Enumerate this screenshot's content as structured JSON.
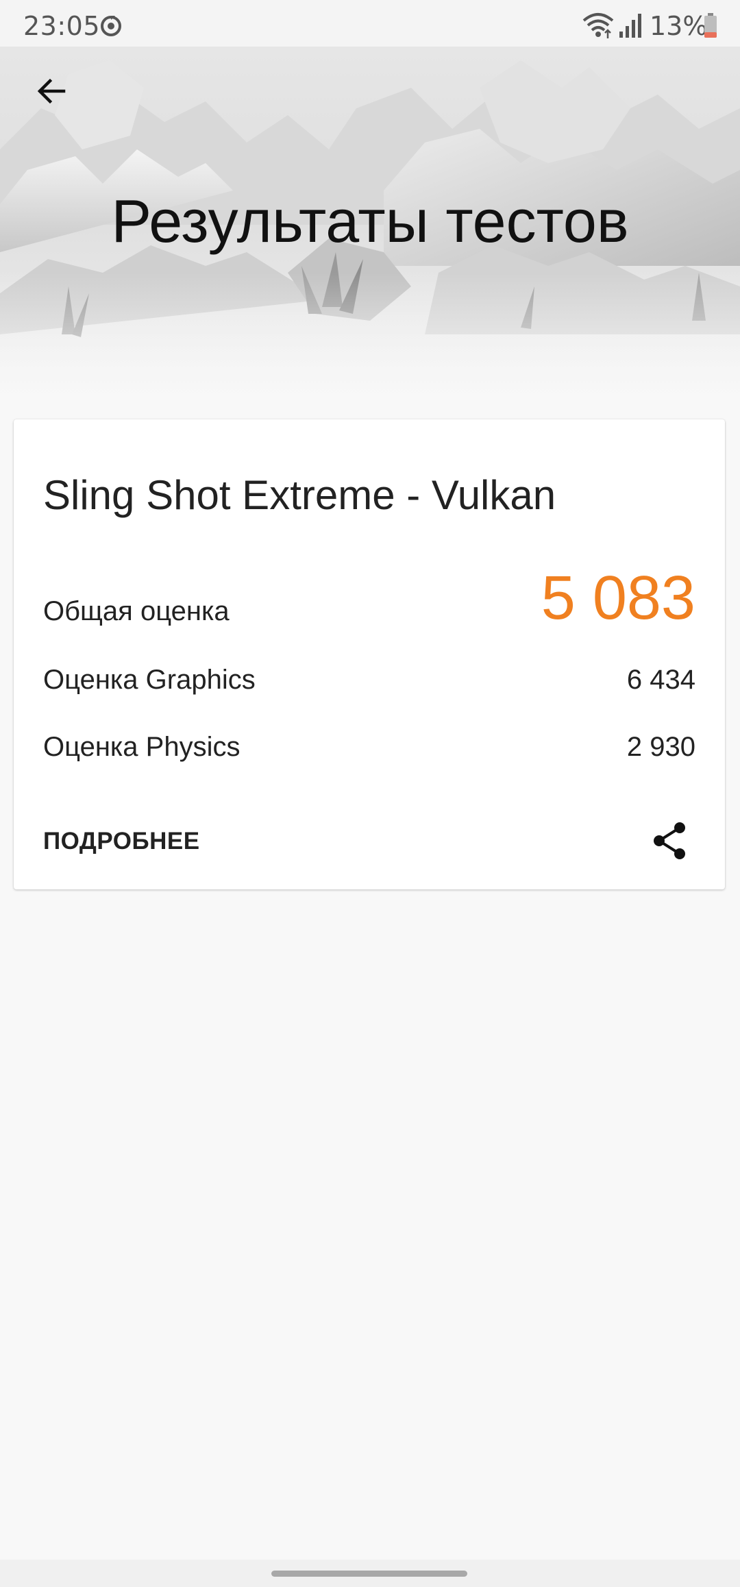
{
  "status_bar": {
    "time": "23:05",
    "battery_percent": "13%",
    "icons": [
      "sync-icon",
      "wifi-icon",
      "signal-icon",
      "battery-icon"
    ]
  },
  "header": {
    "title": "Результаты тестов",
    "back_icon": "arrow-left-icon"
  },
  "result_card": {
    "test_name": "Sling Shot Extreme - Vulkan",
    "overall": {
      "label": "Общая оценка",
      "value": "5 083"
    },
    "graphics": {
      "label": "Оценка Graphics",
      "value": "6 434"
    },
    "physics": {
      "label": "Оценка Physics",
      "value": "2 930"
    },
    "details_label": "ПОДРОБНЕЕ",
    "share_icon": "share-icon"
  },
  "colors": {
    "accent": "#f08020",
    "background": "#f8f8f8",
    "card": "#ffffff",
    "text": "#222222"
  }
}
